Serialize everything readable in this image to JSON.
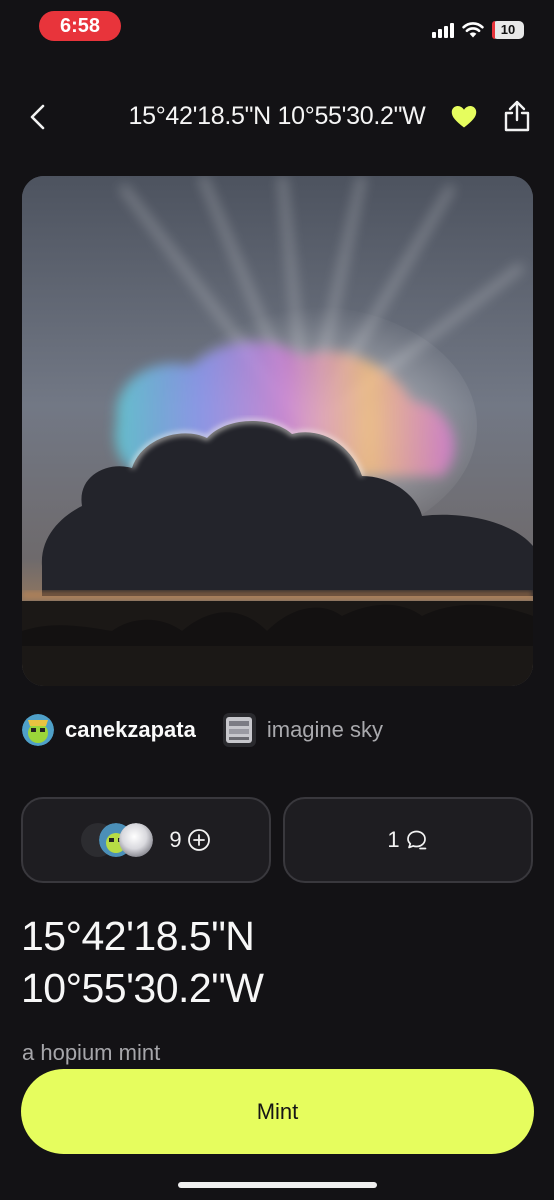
{
  "status_bar": {
    "time": "6:58",
    "battery_level": "10",
    "battery_fraction": 0.1,
    "icons": [
      "signal-icon",
      "wifi-icon",
      "battery-icon"
    ]
  },
  "header": {
    "title": "15°42'18.5\"N 10°55'30.2\"W",
    "back_icon": "chevron-left-icon",
    "favorite_icon": "heart-icon",
    "share_icon": "share-icon"
  },
  "artwork": {
    "subject": "dark cloud over tree line at sunset with iridescent rainbow halo"
  },
  "creator": {
    "name": "canekzapata"
  },
  "collection": {
    "name": "imagine sky"
  },
  "stats": {
    "collectors_count": "9",
    "collect_icon": "plus-circle-icon",
    "comments_count": "1",
    "comment_icon": "comment-icon"
  },
  "title": {
    "line1": "15°42'18.5\"N",
    "line2": "10°55'30.2\"W"
  },
  "description": "a hopium mint",
  "actions": {
    "mint_label": "Mint"
  },
  "colors": {
    "background": "#131215",
    "accent": "#e6fd5e",
    "time_pill": "#e8343b",
    "card_border": "#39383d"
  }
}
